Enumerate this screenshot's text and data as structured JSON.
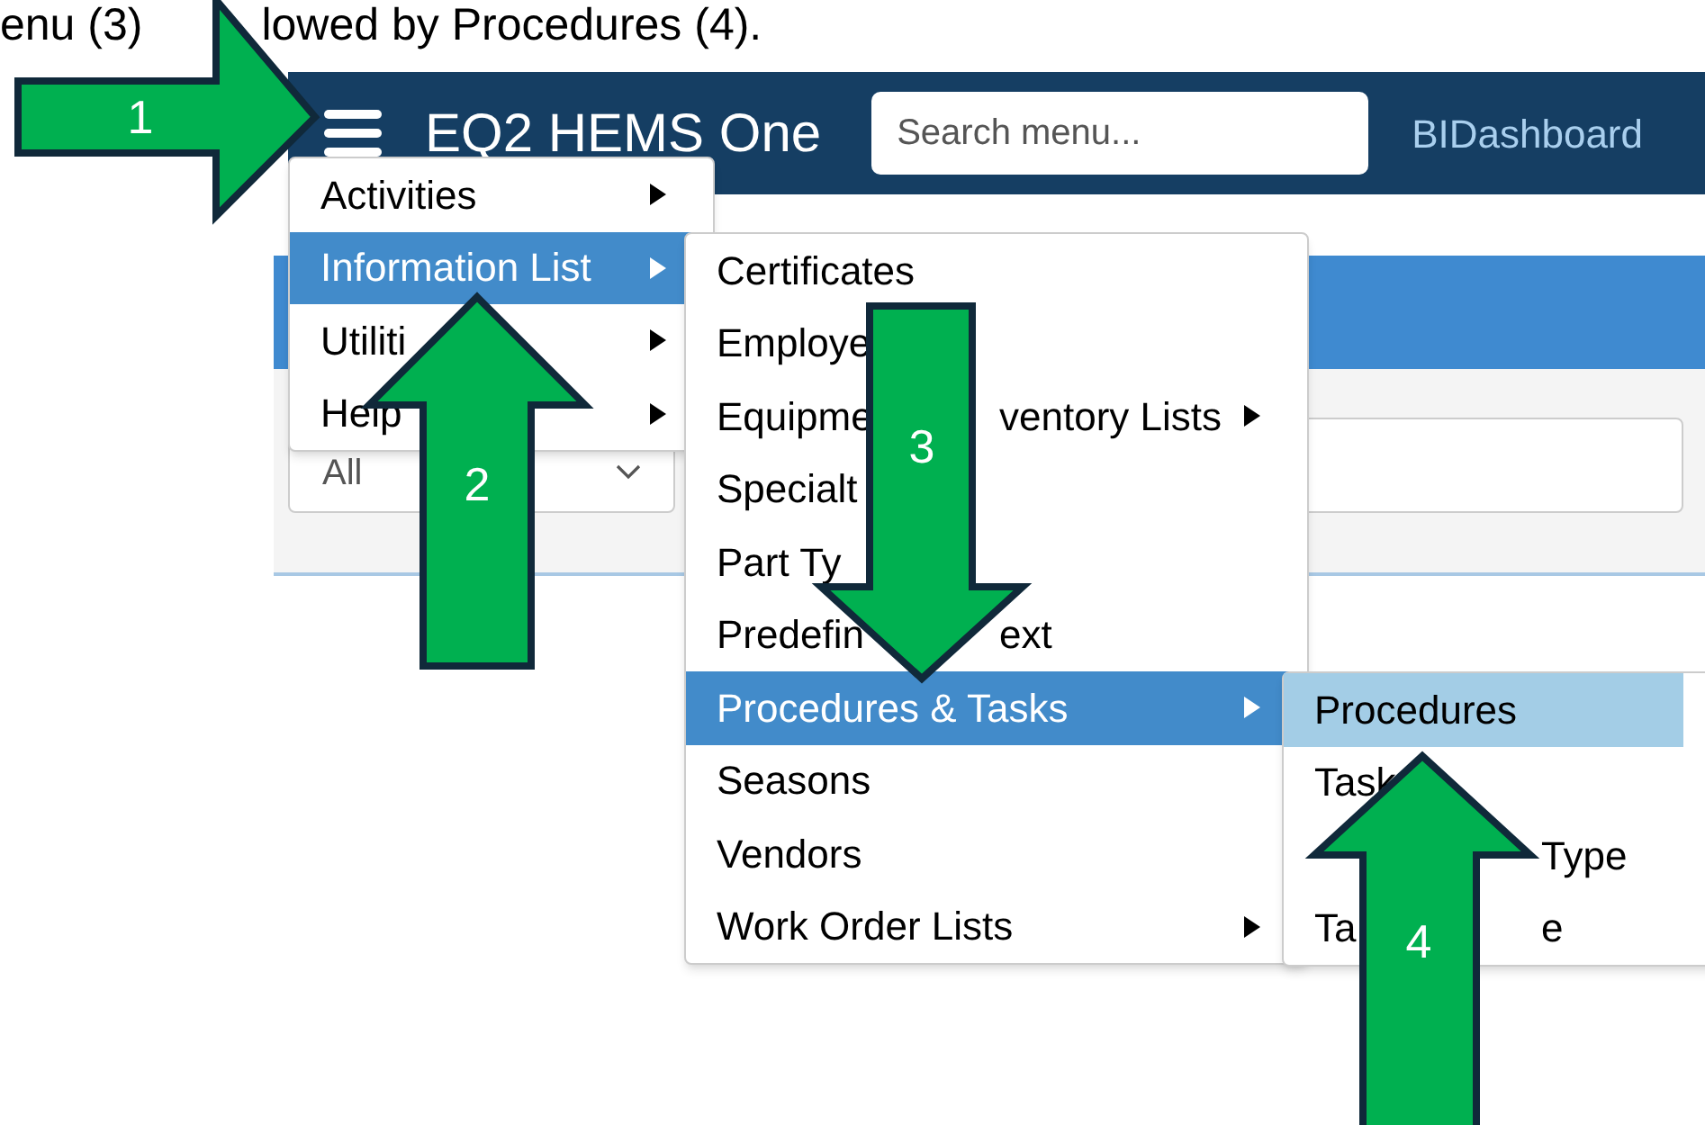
{
  "caption": {
    "before": "enu (3)",
    "after": "lowed by Procedures (4)."
  },
  "navbar": {
    "title": "EQ2 HEMS One",
    "search": {
      "placeholder": "Search menu..."
    },
    "link": "BIDashboard"
  },
  "filter": {
    "value": "All"
  },
  "menu": [
    {
      "label": "Activities",
      "submenu": true,
      "selected": false
    },
    {
      "label": "Information List",
      "submenu": true,
      "selected": true
    },
    {
      "label": "Utiliti",
      "submenu": true,
      "selected": false
    },
    {
      "label": "Help",
      "submenu": true,
      "selected": false
    }
  ],
  "submenu": [
    {
      "label": "Certificates",
      "submenu": false,
      "selected": false
    },
    {
      "label": "Employe",
      "submenu": false,
      "selected": false
    },
    {
      "label": "Equipme",
      "tail": "ventory Lists",
      "submenu": true,
      "selected": false
    },
    {
      "label": "Specialt",
      "submenu": false,
      "selected": false
    },
    {
      "label": "Part Ty",
      "submenu": false,
      "selected": false
    },
    {
      "label": "Predefin",
      "tail": "ext",
      "submenu": false,
      "selected": false
    },
    {
      "label": "Procedures & Tasks",
      "submenu": true,
      "selected": true
    },
    {
      "label": "Seasons",
      "submenu": false,
      "selected": false
    },
    {
      "label": "Vendors",
      "submenu": false,
      "selected": false
    },
    {
      "label": "Work Order Lists",
      "submenu": true,
      "selected": false
    }
  ],
  "subsubmenu": [
    {
      "label": "Procedures",
      "selected": true
    },
    {
      "label": "Task",
      "selected": false
    },
    {
      "tail": "Type",
      "selected": false
    },
    {
      "label": "Ta",
      "tail": "e",
      "selected": false
    }
  ],
  "annotations": [
    {
      "number": "1"
    },
    {
      "number": "2"
    },
    {
      "number": "3"
    },
    {
      "number": "4"
    }
  ]
}
